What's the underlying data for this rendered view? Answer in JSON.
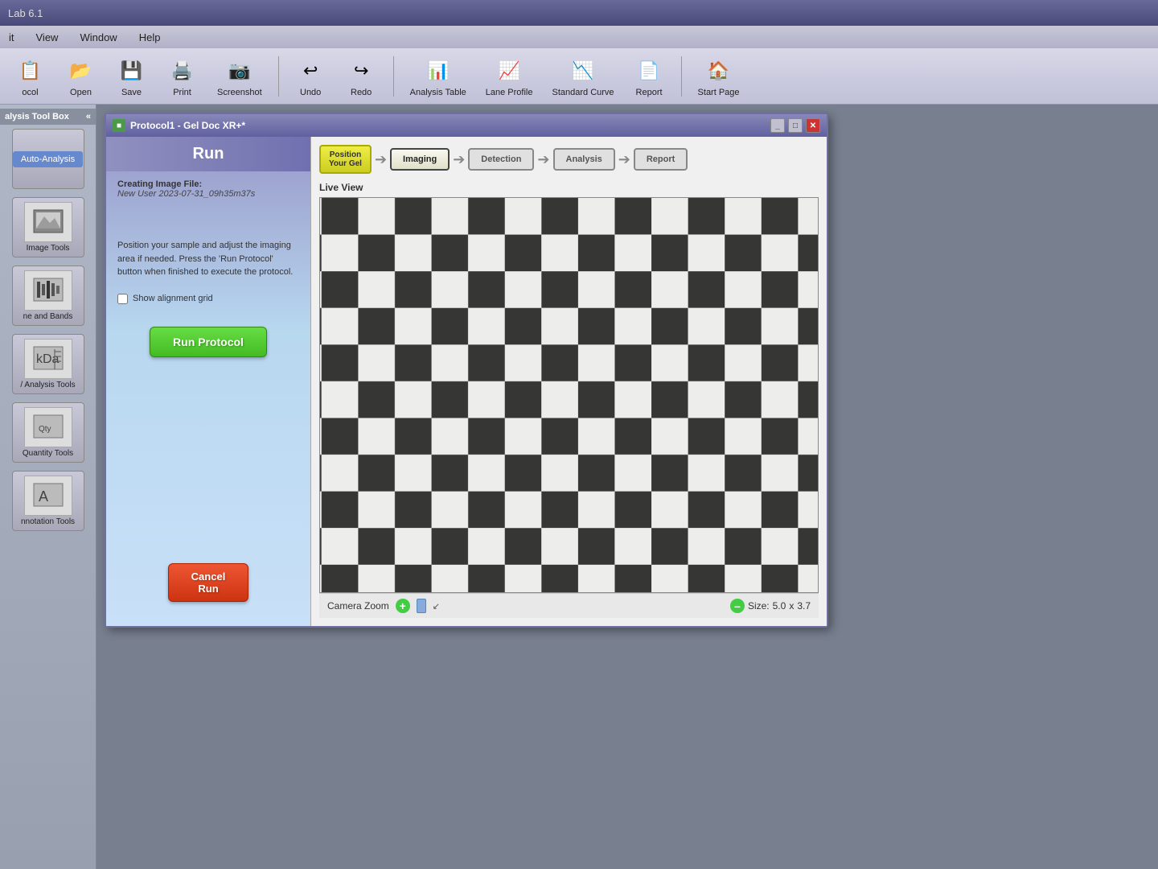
{
  "titlebar": {
    "label": "Lab 6.1"
  },
  "menubar": {
    "items": [
      "it",
      "View",
      "Window",
      "Help"
    ]
  },
  "toolbar": {
    "items": [
      {
        "id": "ocol",
        "label": "ocol",
        "icon": "📋"
      },
      {
        "id": "open",
        "label": "Open",
        "icon": "📂"
      },
      {
        "id": "save",
        "label": "Save",
        "icon": "💾"
      },
      {
        "id": "print",
        "label": "Print",
        "icon": "🖨️"
      },
      {
        "id": "screenshot",
        "label": "Screenshot",
        "icon": "📷"
      },
      {
        "id": "undo",
        "label": "Undo",
        "icon": "↩"
      },
      {
        "id": "redo",
        "label": "Redo",
        "icon": "↪"
      },
      {
        "id": "analysis-table",
        "label": "Analysis Table",
        "icon": "📊"
      },
      {
        "id": "lane-profile",
        "label": "Lane Profile",
        "icon": "📈"
      },
      {
        "id": "standard-curve",
        "label": "Standard Curve",
        "icon": "📉"
      },
      {
        "id": "report",
        "label": "Report",
        "icon": "📄"
      },
      {
        "id": "start-page",
        "label": "Start Page",
        "icon": "🏠"
      }
    ]
  },
  "sidebar": {
    "header": "alysis Tool Box",
    "tools": [
      {
        "id": "auto-analysis",
        "label": "Auto-Analysis"
      },
      {
        "id": "image-tools",
        "label": "Image Tools"
      },
      {
        "id": "lane-bands",
        "label": "ne and Bands"
      },
      {
        "id": "analysis-tools",
        "label": "/ Analysis Tools"
      },
      {
        "id": "quantity-tools",
        "label": "Quantity Tools"
      },
      {
        "id": "annotation-tools",
        "label": "nnotation Tools"
      }
    ]
  },
  "window": {
    "title": "Protocol1 - Gel Doc XR+*",
    "icon": "■"
  },
  "run_panel": {
    "header": "Run",
    "creating_label": "Creating Image File:",
    "creating_value": "New User 2023-07-31_09h35m37s",
    "instructions": "Position your sample and adjust the imaging area if needed. Press the 'Run Protocol' button when finished to execute the protocol.",
    "show_alignment_grid": "Show alignment grid",
    "run_protocol_btn": "Run Protocol",
    "cancel_btn_line1": "Cancel",
    "cancel_btn_line2": "Run"
  },
  "workflow": {
    "steps": [
      {
        "id": "position",
        "label": "Position\nYour Gel",
        "state": "active"
      },
      {
        "id": "imaging",
        "label": "Imaging",
        "state": "current"
      },
      {
        "id": "detection",
        "label": "Detection",
        "state": "inactive"
      },
      {
        "id": "analysis",
        "label": "Analysis",
        "state": "inactive"
      },
      {
        "id": "report",
        "label": "Report",
        "state": "inactive"
      }
    ]
  },
  "live_view": {
    "label": "Live View"
  },
  "camera_zoom": {
    "label": "Camera Zoom",
    "size_label": "Size:",
    "size_x": "5.0",
    "x_separator": "x",
    "size_y": "3.7"
  }
}
